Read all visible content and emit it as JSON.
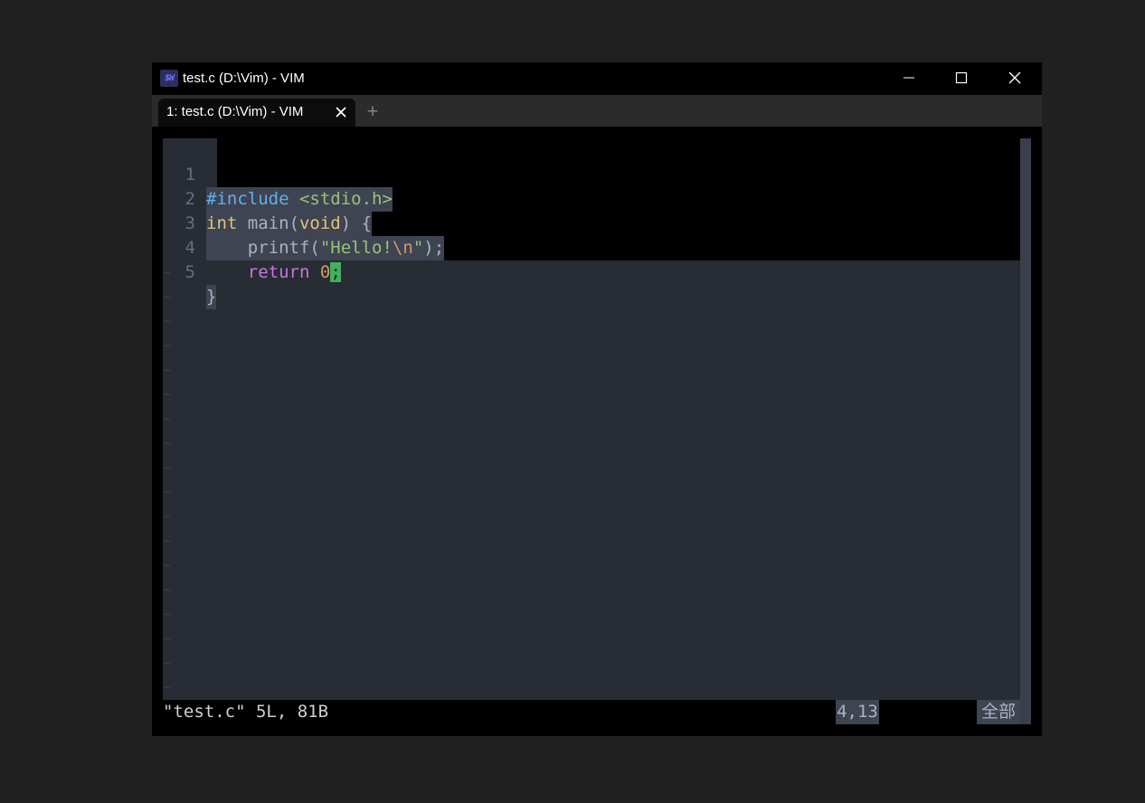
{
  "window": {
    "title": "test.c (D:\\Vim) - VIM",
    "icon_label": "$W",
    "buttons": {
      "minimize": "minimize-icon",
      "maximize": "maximize-icon",
      "close": "close-icon"
    }
  },
  "tabs": [
    {
      "label": "1: test.c (D:\\Vim) - VIM",
      "active": true,
      "close_icon": "close-icon"
    }
  ],
  "new_tab": {
    "label": "+"
  },
  "editor": {
    "lines": [
      {
        "number": "1",
        "tokens": [
          "#include",
          " ",
          "<stdio.h>"
        ]
      },
      {
        "number": "2",
        "tokens": [
          "int",
          " main(",
          "void",
          ") {"
        ]
      },
      {
        "number": "3",
        "tokens": [
          "    printf(",
          "\"Hello!",
          "\\n",
          "\"",
          ");"
        ]
      },
      {
        "number": "4",
        "tokens": [
          "    ",
          "return",
          " ",
          "0",
          ";"
        ]
      },
      {
        "number": "5",
        "tokens": [
          "}"
        ]
      }
    ],
    "tilde": "~",
    "cursor": {
      "line": 4,
      "column": 13
    }
  },
  "statusline": {
    "message": "\"test.c\" 5L, 81B",
    "position": "4,13",
    "scroll": "全部"
  },
  "colors": {
    "background": "#282c34",
    "preprocessor": "#61afef",
    "string": "#98c379",
    "type": "#e5c07b",
    "keyword": "#c678dd",
    "number": "#d19a66",
    "cursor": "#3fb15f"
  }
}
